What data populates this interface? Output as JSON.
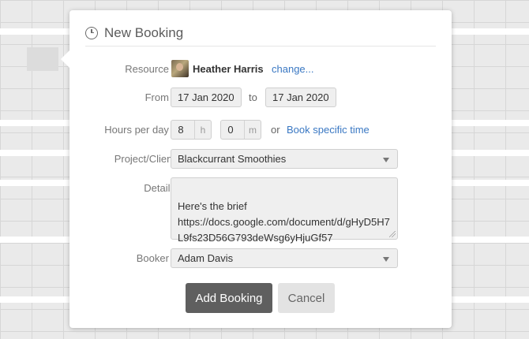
{
  "dialog": {
    "title": "New Booking",
    "title_icon": "clock-icon"
  },
  "resource": {
    "label": "Resource",
    "required_mark": "*",
    "name": "Heather Harris",
    "change_link": "change..."
  },
  "from": {
    "label": "From",
    "required_mark": "*",
    "start_date": "17 Jan 2020",
    "to_label": "to",
    "end_date": "17 Jan 2020"
  },
  "hours": {
    "label": "Hours per day",
    "required_mark": "*",
    "hours_value": "8",
    "hours_unit": "h",
    "minutes_value": "0",
    "minutes_unit": "m",
    "or_label": "or",
    "specific_time_link": "Book specific time"
  },
  "project": {
    "label": "Project/Client",
    "selected": "Blackcurrant Smoothies"
  },
  "details": {
    "label": "Details",
    "text": "Here's the brief\nhttps://docs.google.com/document/d/gHyD5H7L9fs23D56G793deWsg6yHjuGf57"
  },
  "booker": {
    "label": "Booker",
    "required_mark": "*",
    "selected": "Adam Davis"
  },
  "actions": {
    "primary": "Add Booking",
    "secondary": "Cancel"
  }
}
